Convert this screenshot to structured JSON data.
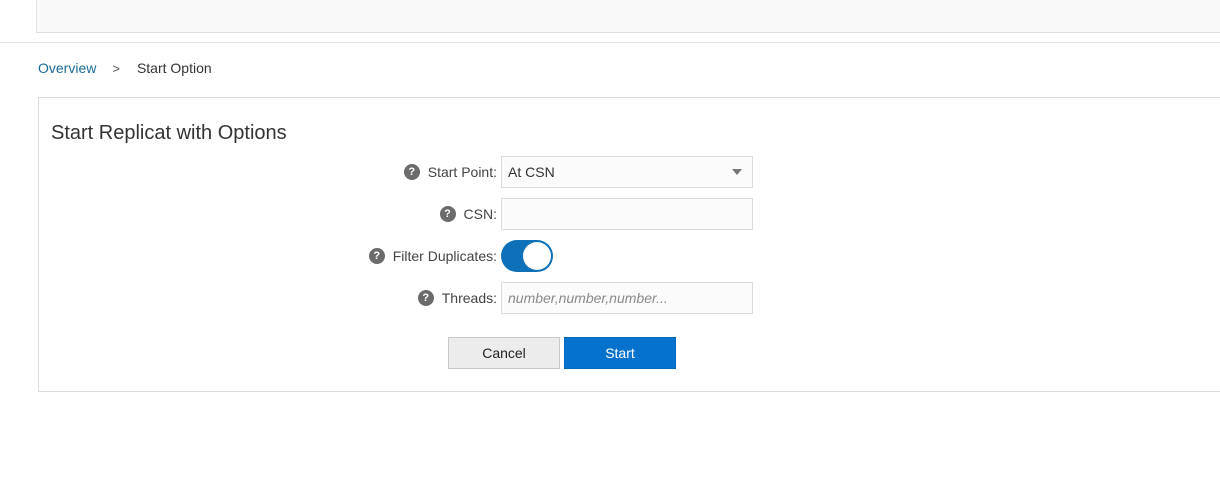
{
  "breadcrumb": {
    "overview": "Overview",
    "separator": ">",
    "current": "Start Option"
  },
  "panel": {
    "title": "Start Replicat with Options"
  },
  "form": {
    "start_point": {
      "label": "Start Point:",
      "value": "At CSN"
    },
    "csn": {
      "label": "CSN:",
      "value": ""
    },
    "filter_duplicates": {
      "label": "Filter Duplicates:",
      "enabled": true
    },
    "threads": {
      "label": "Threads:",
      "placeholder": "number,number,number..."
    },
    "help_glyph": "?"
  },
  "buttons": {
    "cancel": "Cancel",
    "start": "Start"
  },
  "colors": {
    "accent": "#0572ce",
    "toggle_on": "#0e70b8",
    "link": "#1a6b97"
  },
  "icons": {
    "help": "help-circle-icon",
    "dropdown": "chevron-down-icon"
  }
}
